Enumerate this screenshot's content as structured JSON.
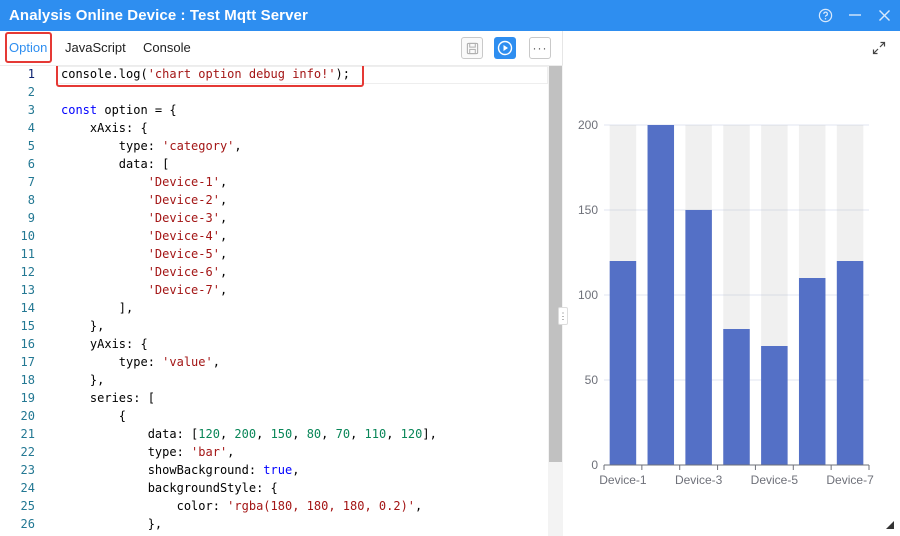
{
  "window": {
    "title": "Analysis Online Device : Test Mqtt Server",
    "buttons": {
      "help": "help-icon",
      "minimize": "minimize-icon",
      "close": "close-icon"
    }
  },
  "tabs": [
    {
      "label": "Option",
      "active": true
    },
    {
      "label": "JavaScript",
      "active": false
    },
    {
      "label": "Console",
      "active": false
    }
  ],
  "toolbar": {
    "save": "save-icon",
    "run": "play-icon",
    "more": "···"
  },
  "editor": {
    "lines": [
      [
        [
          "console.log(",
          "p"
        ],
        [
          "'chart option debug info!'",
          "s"
        ],
        [
          ");",
          "p"
        ]
      ],
      [],
      [
        [
          "const",
          "k"
        ],
        [
          " option = {",
          "p"
        ]
      ],
      [
        [
          "    xAxis: {",
          "p"
        ]
      ],
      [
        [
          "        type: ",
          "p"
        ],
        [
          "'category'",
          "s"
        ],
        [
          ",",
          "p"
        ]
      ],
      [
        [
          "        data: [",
          "p"
        ]
      ],
      [
        [
          "            ",
          "p"
        ],
        [
          "'Device-1'",
          "s"
        ],
        [
          ",",
          "p"
        ]
      ],
      [
        [
          "            ",
          "p"
        ],
        [
          "'Device-2'",
          "s"
        ],
        [
          ",",
          "p"
        ]
      ],
      [
        [
          "            ",
          "p"
        ],
        [
          "'Device-3'",
          "s"
        ],
        [
          ",",
          "p"
        ]
      ],
      [
        [
          "            ",
          "p"
        ],
        [
          "'Device-4'",
          "s"
        ],
        [
          ",",
          "p"
        ]
      ],
      [
        [
          "            ",
          "p"
        ],
        [
          "'Device-5'",
          "s"
        ],
        [
          ",",
          "p"
        ]
      ],
      [
        [
          "            ",
          "p"
        ],
        [
          "'Device-6'",
          "s"
        ],
        [
          ",",
          "p"
        ]
      ],
      [
        [
          "            ",
          "p"
        ],
        [
          "'Device-7'",
          "s"
        ],
        [
          ",",
          "p"
        ]
      ],
      [
        [
          "        ],",
          "p"
        ]
      ],
      [
        [
          "    },",
          "p"
        ]
      ],
      [
        [
          "    yAxis: {",
          "p"
        ]
      ],
      [
        [
          "        type: ",
          "p"
        ],
        [
          "'value'",
          "s"
        ],
        [
          ",",
          "p"
        ]
      ],
      [
        [
          "    },",
          "p"
        ]
      ],
      [
        [
          "    series: [",
          "p"
        ]
      ],
      [
        [
          "        {",
          "p"
        ]
      ],
      [
        [
          "            data: [",
          "p"
        ],
        [
          "120",
          "n"
        ],
        [
          ", ",
          "p"
        ],
        [
          "200",
          "n"
        ],
        [
          ", ",
          "p"
        ],
        [
          "150",
          "n"
        ],
        [
          ", ",
          "p"
        ],
        [
          "80",
          "n"
        ],
        [
          ", ",
          "p"
        ],
        [
          "70",
          "n"
        ],
        [
          ", ",
          "p"
        ],
        [
          "110",
          "n"
        ],
        [
          ", ",
          "p"
        ],
        [
          "120",
          "n"
        ],
        [
          "],",
          "p"
        ]
      ],
      [
        [
          "            type: ",
          "p"
        ],
        [
          "'bar'",
          "s"
        ],
        [
          ",",
          "p"
        ]
      ],
      [
        [
          "            showBackground: ",
          "p"
        ],
        [
          "true",
          "k"
        ],
        [
          ",",
          "p"
        ]
      ],
      [
        [
          "            backgroundStyle: {",
          "p"
        ]
      ],
      [
        [
          "                color: ",
          "p"
        ],
        [
          "'rgba(180, 180, 180, 0.2)'",
          "s"
        ],
        [
          ",",
          "p"
        ]
      ],
      [
        [
          "            },",
          "p"
        ]
      ]
    ],
    "line_numbers": [
      "1",
      "2",
      "3",
      "4",
      "5",
      "6",
      "7",
      "8",
      "9",
      "10",
      "11",
      "12",
      "13",
      "14",
      "15",
      "16",
      "17",
      "18",
      "19",
      "20",
      "21",
      "22",
      "23",
      "24",
      "25",
      "26"
    ],
    "active_line": 1,
    "colors": {
      "string": "#a31515",
      "number": "#098658",
      "keyword": "#0000ff",
      "line_number": "#237893"
    }
  },
  "chart_data": {
    "type": "bar",
    "categories": [
      "Device-1",
      "Device-2",
      "Device-3",
      "Device-4",
      "Device-5",
      "Device-6",
      "Device-7"
    ],
    "x_tick_labels_shown": [
      "Device-1",
      "Device-3",
      "Device-5",
      "Device-7"
    ],
    "values": [
      120,
      200,
      150,
      80,
      70,
      110,
      120
    ],
    "ylim": [
      0,
      200
    ],
    "y_ticks": [
      0,
      50,
      100,
      150,
      200
    ],
    "background_max": 200,
    "bar_color": "#5470c6",
    "background_color": "rgba(180, 180, 180, 0.2)",
    "grid": true
  },
  "highlight_color": "#e53935",
  "accent_color": "#2e8ef0"
}
